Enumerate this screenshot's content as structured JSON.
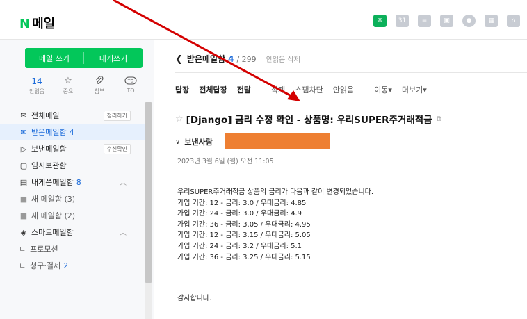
{
  "app": {
    "logo_n": "N",
    "logo_text": "메일"
  },
  "top_icons": [
    "mail-icon",
    "calendar-icon",
    "list-icon",
    "contacts-icon",
    "shield-icon",
    "grid-icon",
    "home-icon"
  ],
  "sidebar": {
    "compose": "메일 쓰기",
    "compose_self": "내게쓰기",
    "quick": [
      {
        "value": "14",
        "label": "안읽음"
      },
      {
        "value": "☆",
        "label": "중요"
      },
      {
        "value": "⌀",
        "label": "첨부"
      },
      {
        "value": "TO",
        "label": "TO"
      }
    ],
    "items": [
      {
        "icon": "✉",
        "label": "전체메일",
        "chip": "정리하기"
      },
      {
        "icon": "✉",
        "label": "받은메일함",
        "count": "4"
      },
      {
        "icon": "▷",
        "label": "보낸메일함",
        "chip": "수신확인"
      },
      {
        "icon": "▢",
        "label": "임시보관함"
      },
      {
        "icon": "▤",
        "label": "내게쓴메일함",
        "count": "8"
      },
      {
        "icon": "■",
        "label": "새 메일함 (3)"
      },
      {
        "icon": "■",
        "label": "새 메일함 (2)"
      },
      {
        "icon": "◈",
        "label": "스마트메일함"
      },
      {
        "label": "프로모션"
      },
      {
        "label": "청구·결제",
        "count": "2"
      }
    ]
  },
  "main": {
    "folder": "받은메일함",
    "unread": "4",
    "total": "/ 299",
    "delete_unread": "안읽음 삭제",
    "toolbar_bold": [
      "답장",
      "전체답장",
      "전달"
    ],
    "toolbar_normal": [
      "삭제",
      "스팸차단",
      "안읽음"
    ],
    "toolbar_dropdowns": [
      "이동▾",
      "더보기▾"
    ],
    "subject": "[Django] 금리 수정 확인 - 상품명: 우리SUPER주거래적금",
    "sender_label": "보낸사람",
    "date": "2023년 3월 6일 (월) 오전 11:05",
    "body_lines": [
      "우리SUPER주거래적금 상품의 금리가 다음과 같이 변경되었습니다.",
      "가입 기간: 12 - 금리: 3.0 / 우대금리: 4.85",
      "가입 기간: 24 - 금리: 3.0 / 우대금리: 4.9",
      "가입 기간: 36 - 금리: 3.05 / 우대금리: 4.95",
      "가입 기간: 12 - 금리: 3.15 / 우대금리: 5.05",
      "가입 기간: 24 - 금리: 3.2 / 우대금리: 5.1",
      "가입 기간: 36 - 금리: 3.25 / 우대금리: 5.15"
    ],
    "thanks": "감사합니다."
  },
  "colors": {
    "brand": "#03c75a",
    "link": "#1a6ad9",
    "redaction": "#ee7f32",
    "annotation": "#d40000"
  }
}
